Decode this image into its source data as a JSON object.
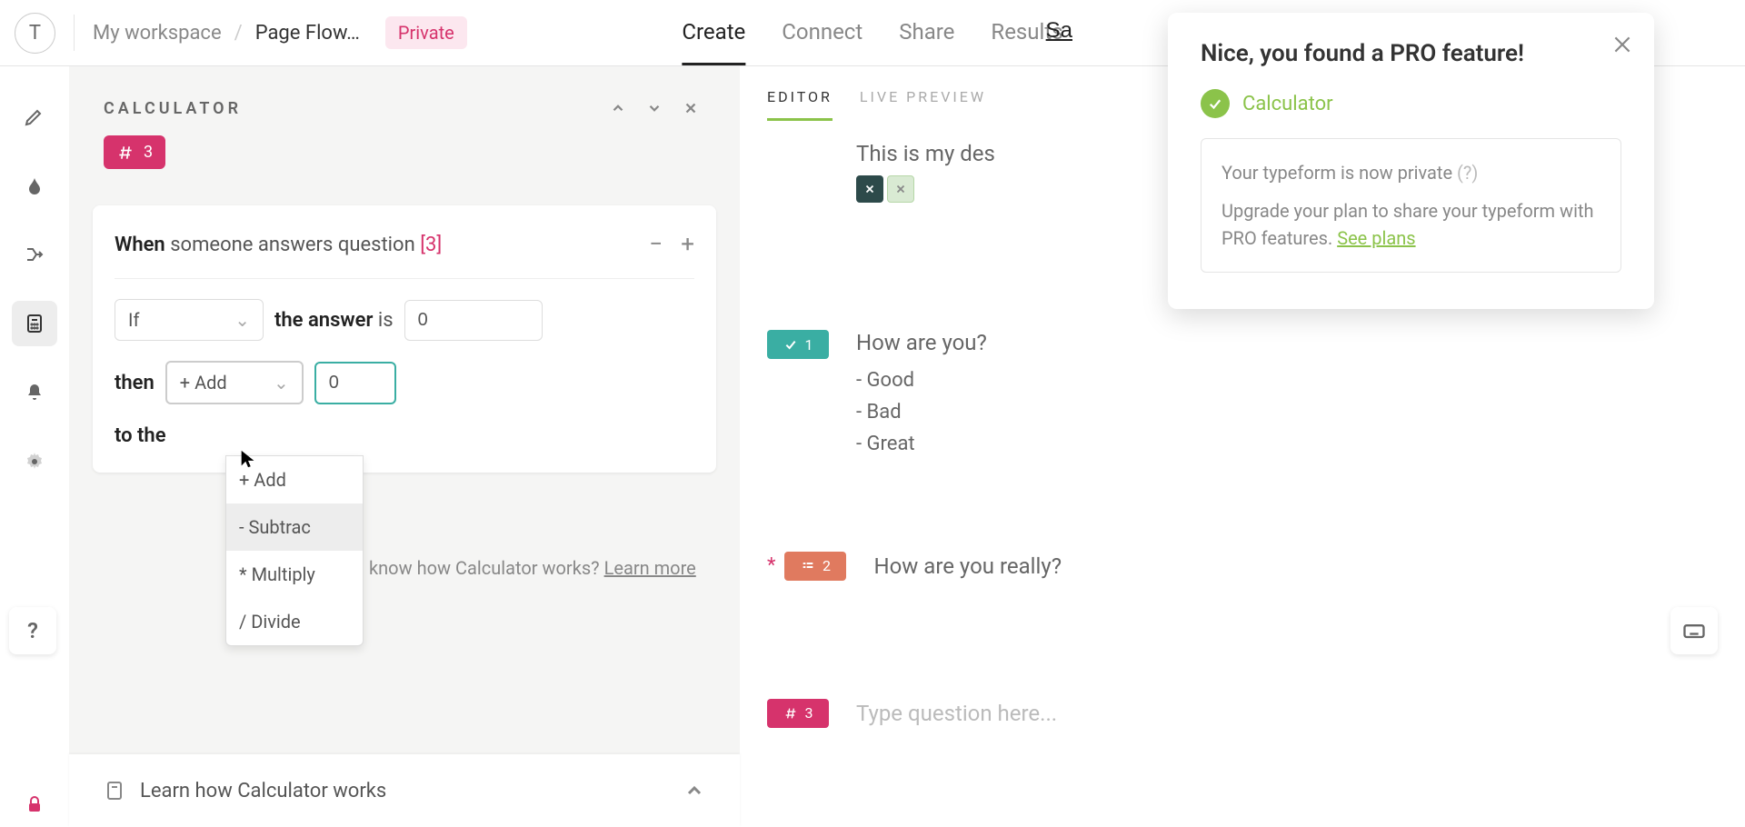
{
  "header": {
    "avatar": "T",
    "workspace": "My workspace",
    "project": "Page Flow…",
    "private": "Private",
    "tabs": {
      "create": "Create",
      "connect": "Connect",
      "share": "Share",
      "results": "Results"
    },
    "save": "Sa"
  },
  "calculator": {
    "title": "CALCULATOR",
    "badge_num": "3",
    "when_label": "When",
    "when_text": "someone answers question",
    "when_qnum": "[3]",
    "if_label": "If",
    "the_answer": "the answer",
    "is": "is",
    "answer_value": "0",
    "then": "then",
    "op_selected": "+ Add",
    "op_value": "0",
    "to_the": "to the",
    "dropdown": {
      "add": "+ Add",
      "subtract": "- Subtrac",
      "multiply": "* Multiply",
      "divide": "/ Divide"
    },
    "footer_text": "know how Calculator works?",
    "footer_link": "Learn more",
    "help_bar": "Learn how Calculator works"
  },
  "editor": {
    "tabs": {
      "editor": "EDITOR",
      "live_preview": "LIVE PREVIEW"
    },
    "q_desc": "This is my des",
    "q1": {
      "num": "1",
      "title": "How are you?",
      "opts": [
        "-  Good",
        "-  Bad",
        "-  Great"
      ]
    },
    "q2": {
      "num": "2",
      "title": "How are you really?"
    },
    "q3": {
      "num": "3",
      "placeholder": "Type question here..."
    }
  },
  "popup": {
    "title": "Nice, you found a PRO feature!",
    "feature": "Calculator",
    "line1": "Your typeform is now private",
    "line1_q": "(?)",
    "line2_a": "Upgrade your plan to share your typeform with PRO features. ",
    "line2_link": "See plans"
  },
  "help_btn": "?"
}
